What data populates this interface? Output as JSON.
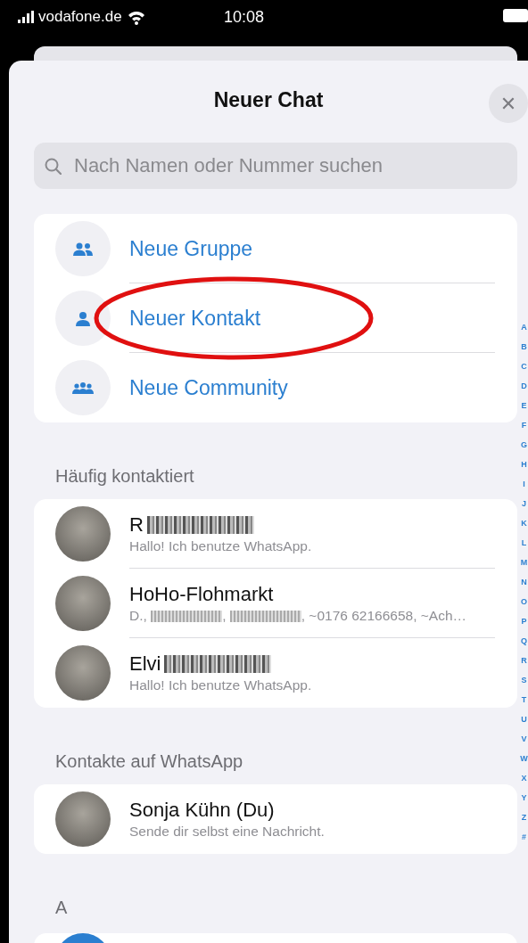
{
  "status_bar": {
    "carrier": "vodafone.de",
    "time": "10:08"
  },
  "sheet": {
    "title": "Neuer Chat",
    "close_symbol": "✕"
  },
  "search": {
    "placeholder": "Nach Namen oder Nummer suchen"
  },
  "actions": [
    {
      "kind": "group",
      "label": "Neue Gruppe",
      "highlighted": false
    },
    {
      "kind": "contact",
      "label": "Neuer Kontakt",
      "highlighted": true
    },
    {
      "kind": "community",
      "label": "Neue Community",
      "highlighted": false
    }
  ],
  "sections": [
    {
      "title": "Häufig kontaktiert",
      "contacts": [
        {
          "name": "R",
          "redacted": true,
          "subtitle_parts": [
            "Hallo! Ich benutze WhatsApp."
          ]
        },
        {
          "name": "HoHo-Flohmarkt",
          "redacted": false,
          "subtitle_parts": [
            "D., ",
            ", ",
            ", ~0176 62166658, ~Ach…"
          ]
        },
        {
          "name": "Elvi",
          "redacted": true,
          "subtitle_parts": [
            "Hallo! Ich benutze WhatsApp."
          ]
        }
      ]
    },
    {
      "title": "Kontakte auf WhatsApp",
      "contacts": [
        {
          "name": "Sonja Kühn (Du)",
          "redacted": false,
          "subtitle_parts": [
            "Sende dir selbst eine Nachricht."
          ]
        }
      ]
    },
    {
      "title": "A"
    }
  ],
  "alphabet_index": [
    "A",
    "B",
    "C",
    "D",
    "E",
    "F",
    "G",
    "H",
    "I",
    "J",
    "K",
    "L",
    "M",
    "N",
    "O",
    "P",
    "Q",
    "R",
    "S",
    "T",
    "U",
    "V",
    "W",
    "X",
    "Y",
    "Z",
    "#"
  ]
}
